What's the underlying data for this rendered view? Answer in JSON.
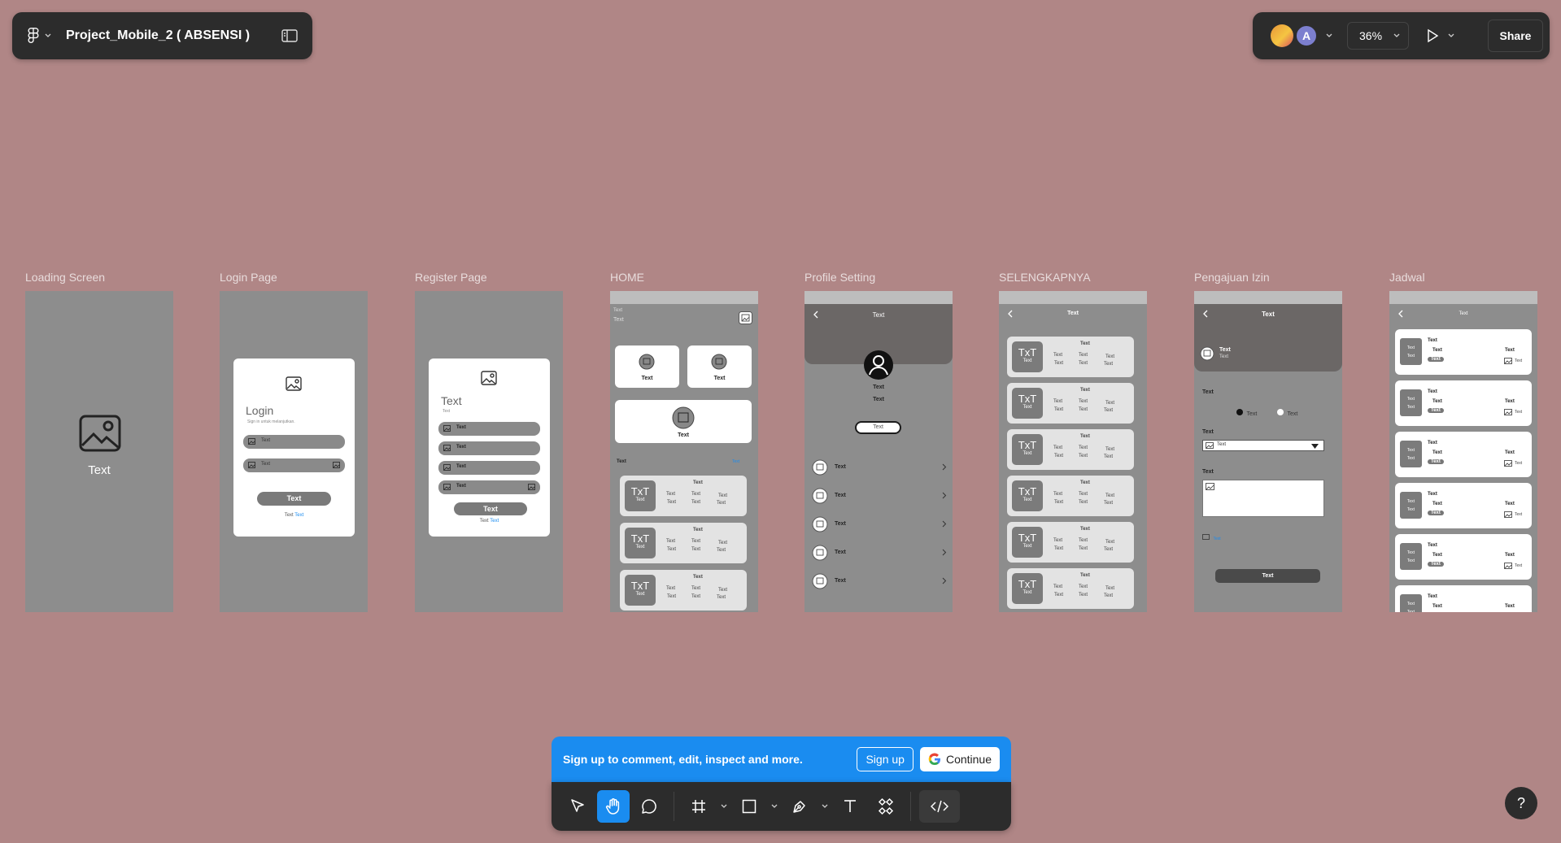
{
  "file": {
    "title": "Project_Mobile_2 ( ABSENSI )"
  },
  "topbar": {
    "avatar_initial": "A",
    "zoom": "36%",
    "share_label": "Share"
  },
  "frames": [
    {
      "label": "Loading Screen"
    },
    {
      "label": "Login Page"
    },
    {
      "label": "Register Page"
    },
    {
      "label": "HOME"
    },
    {
      "label": "Profile Setting"
    },
    {
      "label": "SELENGKAPNYA"
    },
    {
      "label": "Pengajuan Izin"
    },
    {
      "label": "Jadwal"
    }
  ],
  "loading": {
    "text": "Text"
  },
  "login": {
    "title": "Login",
    "subtitle": "Sign in untuk melanjutkan.",
    "field": "Text",
    "button": "Text",
    "footer_a": "Text",
    "footer_b": "Text"
  },
  "register": {
    "title": "Text",
    "subtitle": "Text",
    "field": "Text",
    "button": "Text",
    "footer_a": "Text",
    "footer_b": "Text"
  },
  "home": {
    "hdr_a": "Text",
    "hdr_b": "Text",
    "card": "Text",
    "section": "Text",
    "section_link": "Text",
    "thumb_big": "TxT",
    "thumb_small": "Text",
    "cell": "Text"
  },
  "profile": {
    "title": "Text",
    "name": "Text",
    "sub": "Text",
    "button": "Text",
    "item": "Text"
  },
  "selengkapnya": {
    "title": "Text",
    "thumb_big": "TxT",
    "thumb_small": "Text",
    "cell": "Text"
  },
  "izin": {
    "title": "Text",
    "name": "Text",
    "sub": "Text",
    "label": "Text",
    "opt": "Text",
    "select": "Text",
    "upload": "Text",
    "button": "Text"
  },
  "jadwal": {
    "title": "Text",
    "cell": "Text"
  },
  "signup": {
    "message": "Sign up to comment, edit, inspect and more.",
    "signup_label": "Sign up",
    "continue_label": "Continue"
  },
  "help": {
    "label": "?"
  },
  "colors": {
    "canvas": "#b08686",
    "toolbar": "#2c2c2c",
    "accent": "#1a8cf0"
  }
}
